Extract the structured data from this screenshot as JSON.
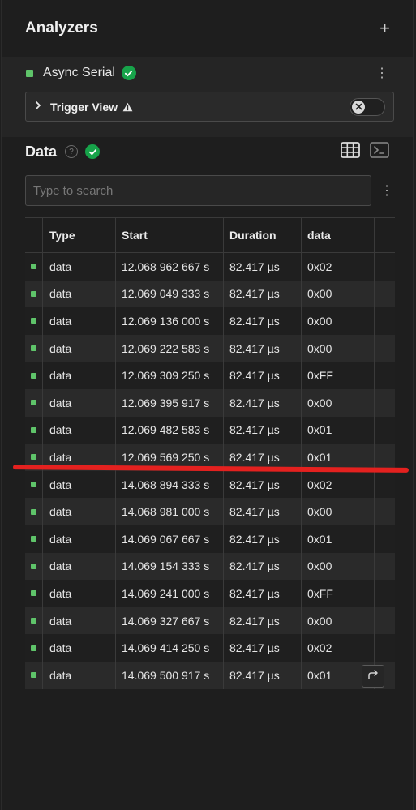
{
  "header": {
    "title": "Analyzers",
    "add_symbol": "+"
  },
  "analyzer": {
    "name": "Async Serial",
    "kebab": "⋮",
    "trigger_label": "Trigger View",
    "chevron": "›"
  },
  "data_section": {
    "title": "Data",
    "help_symbol": "?",
    "search_placeholder": "Type to search",
    "kebab": "⋮"
  },
  "colors": {
    "accent_green": "#5fc46a",
    "check_green": "#17a34a",
    "red_marker": "#e4211f"
  },
  "table": {
    "columns": [
      "Type",
      "Start",
      "Duration",
      "data"
    ],
    "rows": [
      {
        "type": "data",
        "start": "12.068 962 667 s",
        "duration": "82.417 µs",
        "data": "0x02"
      },
      {
        "type": "data",
        "start": "12.069 049 333 s",
        "duration": "82.417 µs",
        "data": "0x00"
      },
      {
        "type": "data",
        "start": "12.069 136 000 s",
        "duration": "82.417 µs",
        "data": "0x00"
      },
      {
        "type": "data",
        "start": "12.069 222 583 s",
        "duration": "82.417 µs",
        "data": "0x00"
      },
      {
        "type": "data",
        "start": "12.069 309 250 s",
        "duration": "82.417 µs",
        "data": "0xFF"
      },
      {
        "type": "data",
        "start": "12.069 395 917 s",
        "duration": "82.417 µs",
        "data": "0x00"
      },
      {
        "type": "data",
        "start": "12.069 482 583 s",
        "duration": "82.417 µs",
        "data": "0x01"
      },
      {
        "type": "data",
        "start": "12.069 569 250 s",
        "duration": "82.417 µs",
        "data": "0x01"
      },
      {
        "type": "data",
        "start": "14.068 894 333 s",
        "duration": "82.417 µs",
        "data": "0x02"
      },
      {
        "type": "data",
        "start": "14.068 981 000 s",
        "duration": "82.417 µs",
        "data": "0x00"
      },
      {
        "type": "data",
        "start": "14.069 067 667 s",
        "duration": "82.417 µs",
        "data": "0x01"
      },
      {
        "type": "data",
        "start": "14.069 154 333 s",
        "duration": "82.417 µs",
        "data": "0x00"
      },
      {
        "type": "data",
        "start": "14.069 241 000 s",
        "duration": "82.417 µs",
        "data": "0xFF"
      },
      {
        "type": "data",
        "start": "14.069 327 667 s",
        "duration": "82.417 µs",
        "data": "0x00"
      },
      {
        "type": "data",
        "start": "14.069 414 250 s",
        "duration": "82.417 µs",
        "data": "0x02"
      },
      {
        "type": "data",
        "start": "14.069 500 917 s",
        "duration": "82.417 µs",
        "data": "0x01"
      }
    ]
  }
}
